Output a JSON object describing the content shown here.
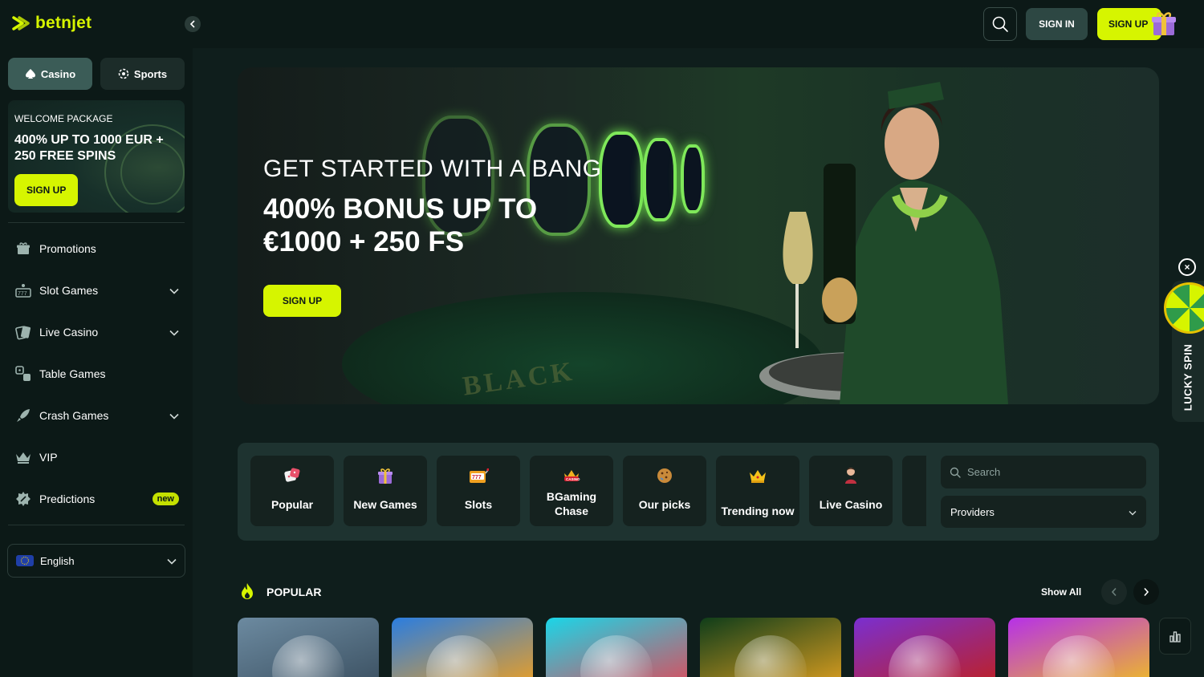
{
  "brand": {
    "name": "betnjet",
    "accent": "#d6f500"
  },
  "topbar": {
    "search_icon": "search-icon",
    "signin_label": "SIGN IN",
    "signup_label": "SIGN UP"
  },
  "sidebar": {
    "tabs": [
      {
        "label": "Casino",
        "icon": "spade-icon",
        "active": true
      },
      {
        "label": "Sports",
        "icon": "soccer-ball-icon",
        "active": false
      }
    ],
    "promo": {
      "kicker": "WELCOME PACKAGE",
      "title": "400% UP TO 1000 EUR + 250 FREE SPINS",
      "button": "SIGN UP"
    },
    "items": [
      {
        "label": "Promotions",
        "icon": "gift-icon",
        "expandable": false
      },
      {
        "label": "Slot Games",
        "icon": "slot-machine-icon",
        "expandable": true
      },
      {
        "label": "Live Casino",
        "icon": "cards-icon",
        "expandable": true
      },
      {
        "label": "Table Games",
        "icon": "table-games-icon",
        "expandable": false
      },
      {
        "label": "Crash Games",
        "icon": "rocket-icon",
        "expandable": true
      },
      {
        "label": "VIP",
        "icon": "crown-icon",
        "expandable": false
      },
      {
        "label": "Predictions",
        "icon": "predictions-icon",
        "expandable": false,
        "badge": "new"
      }
    ],
    "language": "English"
  },
  "hero": {
    "kicker": "GET STARTED WITH A BANG",
    "title": "400% BONUS UP TO €1000 + 250 FS",
    "button": "SIGN UP",
    "table_text": "BLACK"
  },
  "lucky_spin": {
    "label": "LUCKY SPIN"
  },
  "categories": [
    {
      "label": "Popular",
      "icon": "dice-icon"
    },
    {
      "label": "New Games",
      "icon": "gift-box-icon"
    },
    {
      "label": "Slots",
      "icon": "slot-777-icon"
    },
    {
      "label": "BGaming Chase",
      "icon": "casino-chase-icon"
    },
    {
      "label": "Our picks",
      "icon": "cookie-icon"
    },
    {
      "label": "Trending now",
      "icon": "crown-trending-icon"
    },
    {
      "label": "Live Casino",
      "icon": "dealer-icon"
    }
  ],
  "filters": {
    "search_placeholder": "Search",
    "providers_label": "Providers"
  },
  "popular": {
    "title": "POPULAR",
    "show_all": "Show All",
    "tiles": [
      {
        "name": "cowboy-archer",
        "colors": [
          "#6c8aa0",
          "#3a4f60"
        ]
      },
      {
        "name": "golden-pig",
        "colors": [
          "#2a7de0",
          "#f0a020"
        ]
      },
      {
        "name": "couple-selfie",
        "colors": [
          "#1ad6e8",
          "#e04a5a"
        ]
      },
      {
        "name": "money-pyramid",
        "colors": [
          "#0f3d1a",
          "#e0a020"
        ]
      },
      {
        "name": "green-monster",
        "colors": [
          "#7a2fd0",
          "#c02020"
        ]
      },
      {
        "name": "sun-slot",
        "colors": [
          "#b630e8",
          "#f0c020"
        ]
      }
    ]
  }
}
